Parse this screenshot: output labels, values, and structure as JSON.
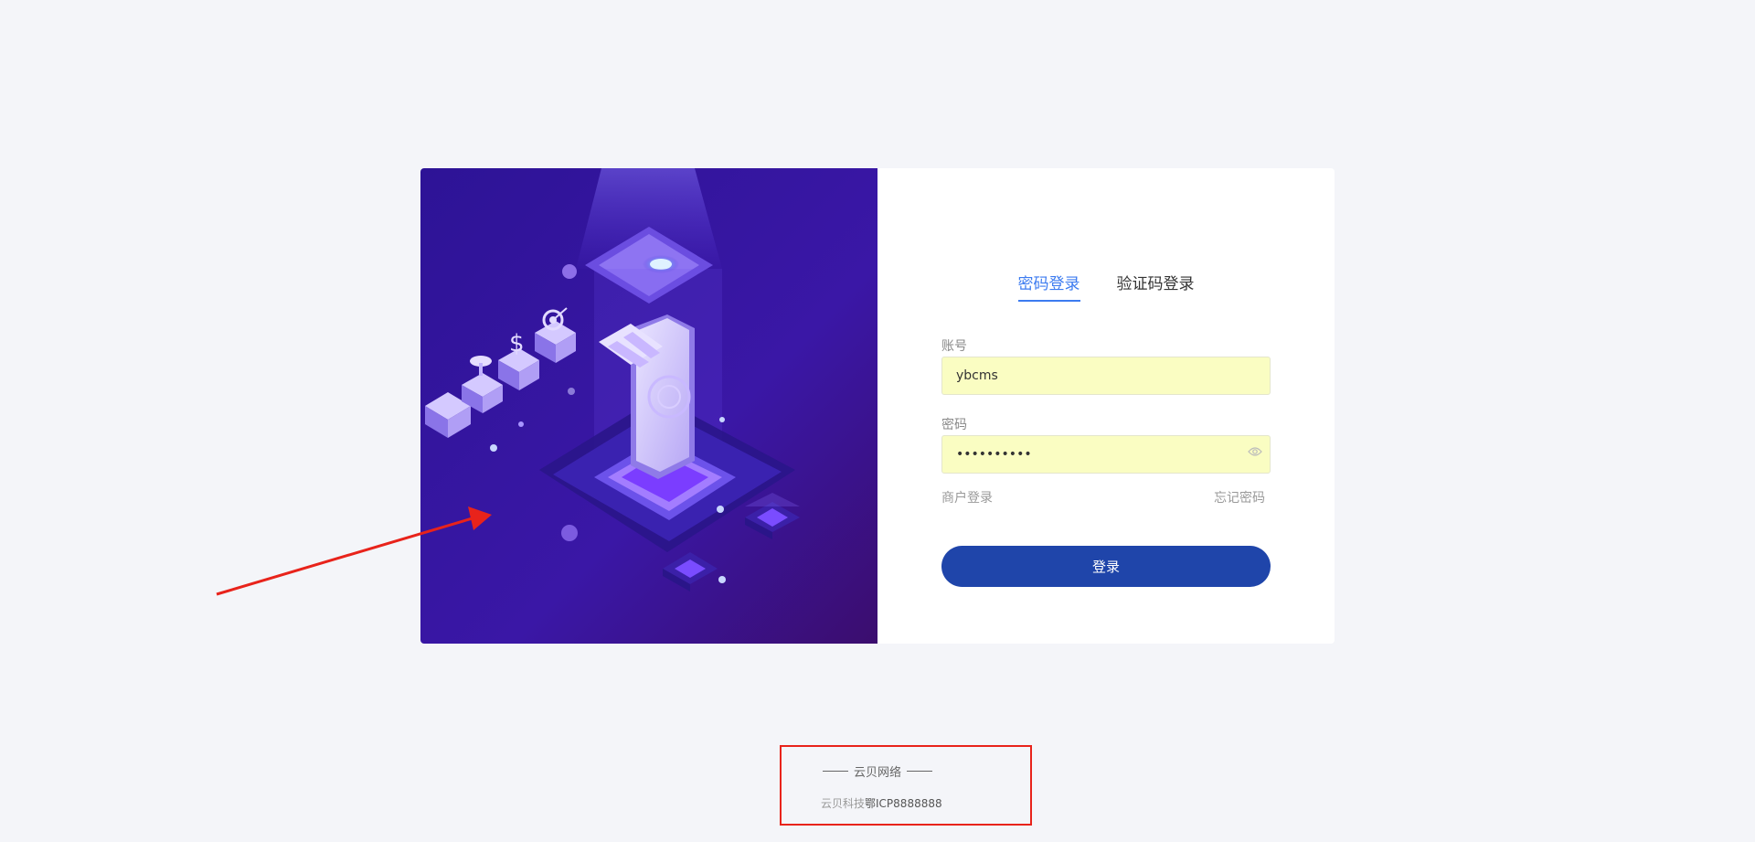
{
  "tabs": [
    {
      "label": "密码登录",
      "active": true
    },
    {
      "label": "验证码登录",
      "active": false
    }
  ],
  "form": {
    "account_label": "账号",
    "account_value": "ybcms",
    "password_label": "密码",
    "password_value": "••••••••••",
    "merchant_login_link": "商户登录",
    "forgot_password_link": "忘记密码",
    "submit_label": "登录"
  },
  "footer": {
    "brand": "云贝网络",
    "company": "云贝科技",
    "icp": "鄂ICP8888888"
  },
  "colors": {
    "accent": "#3c7bf0",
    "button": "#1f45aa",
    "autofill": "#fafdc2",
    "annotation": "#e8231b",
    "illustration_bg": "#3a1a9e"
  },
  "icons": {
    "password_toggle": "eye-icon"
  }
}
